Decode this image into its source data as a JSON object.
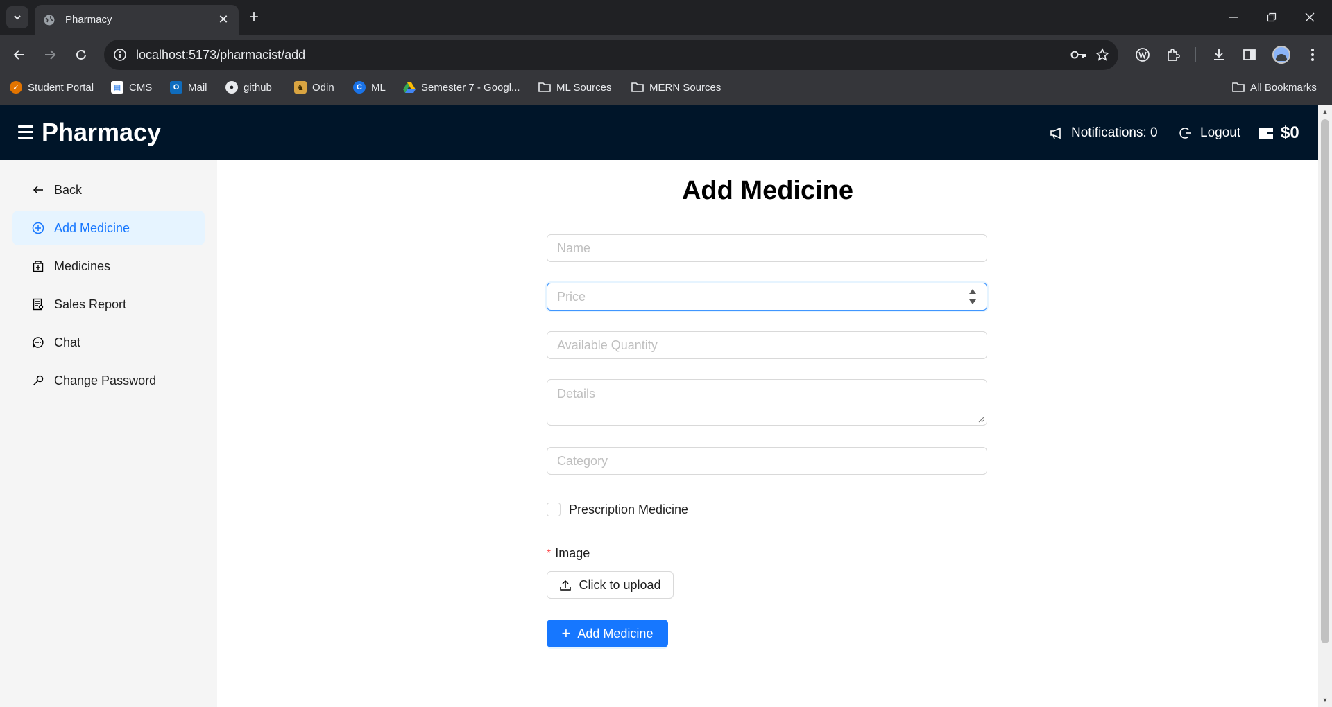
{
  "browser": {
    "tab_title": "Pharmacy",
    "url": "localhost:5173/pharmacist/add",
    "bookmarks": [
      {
        "label": "Student Portal",
        "icon": "student-portal-icon"
      },
      {
        "label": "CMS",
        "icon": "cms-icon"
      },
      {
        "label": "Mail",
        "icon": "outlook-icon"
      },
      {
        "label": "github",
        "icon": "github-icon"
      },
      {
        "label": "Odin",
        "icon": "odin-icon"
      },
      {
        "label": "ML",
        "icon": "c-icon"
      },
      {
        "label": "Semester 7 - Googl...",
        "icon": "google-drive-icon"
      },
      {
        "label": "ML Sources",
        "icon": "folder-icon"
      },
      {
        "label": "MERN Sources",
        "icon": "folder-icon"
      }
    ],
    "all_bookmarks": "All Bookmarks"
  },
  "header": {
    "brand": "Pharmacy",
    "notifications": "Notifications: 0",
    "logout": "Logout",
    "wallet": "$0"
  },
  "sidebar": {
    "items": [
      {
        "label": "Back",
        "icon": "arrow-left-icon",
        "active": false
      },
      {
        "label": "Add Medicine",
        "icon": "plus-circle-icon",
        "active": true
      },
      {
        "label": "Medicines",
        "icon": "medicine-box-icon",
        "active": false
      },
      {
        "label": "Sales Report",
        "icon": "report-icon",
        "active": false
      },
      {
        "label": "Chat",
        "icon": "message-icon",
        "active": false
      },
      {
        "label": "Change Password",
        "icon": "key-icon",
        "active": false
      }
    ]
  },
  "form": {
    "title": "Add Medicine",
    "name_placeholder": "Name",
    "price_placeholder": "Price",
    "quantity_placeholder": "Available Quantity",
    "details_placeholder": "Details",
    "category_placeholder": "Category",
    "prescription_label": "Prescription Medicine",
    "image_label": "Image",
    "image_required_mark": "*",
    "upload_label": "Click to upload",
    "submit_label": "Add Medicine"
  },
  "colors": {
    "header_bg": "#001529",
    "primary": "#1677ff",
    "active_bg": "#e6f4ff"
  }
}
